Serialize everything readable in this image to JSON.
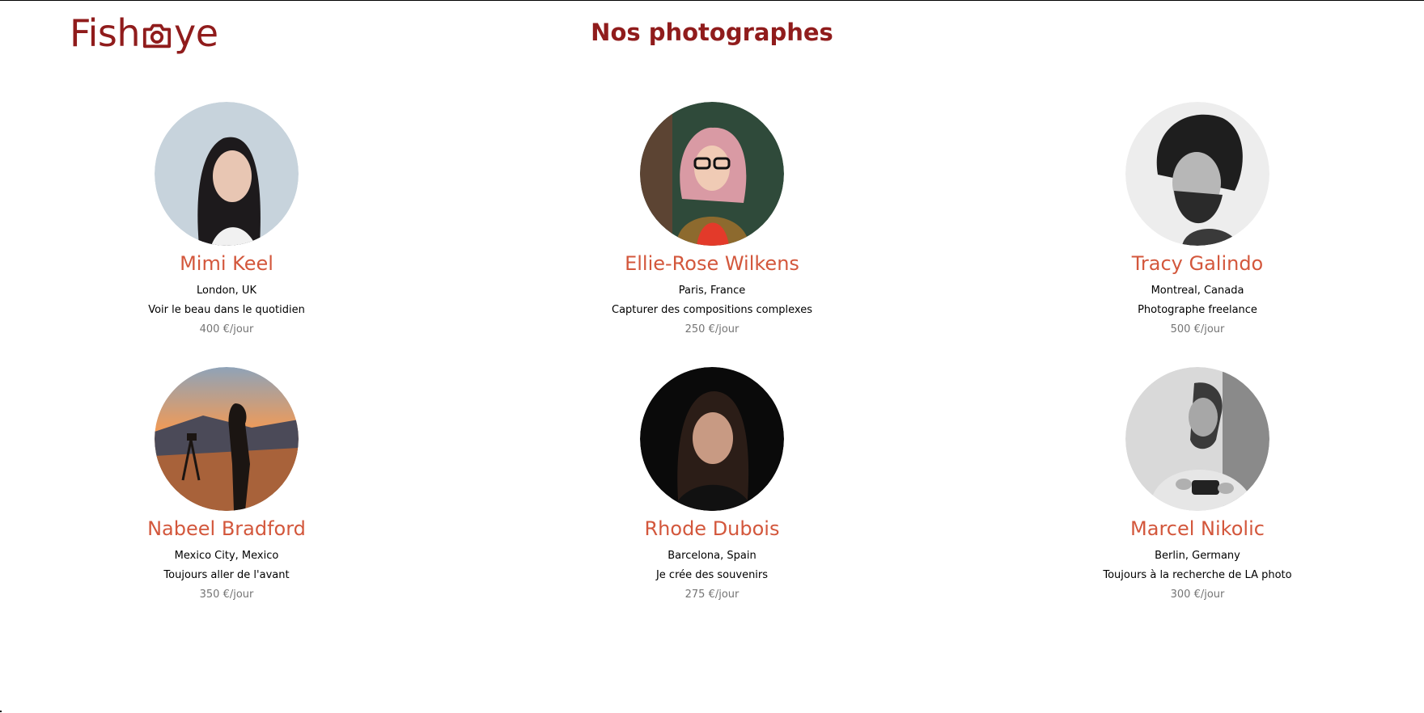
{
  "header": {
    "logo_left": "Fish",
    "logo_right": "ye",
    "logo_icon": "camera-icon",
    "title": "Nos photographes"
  },
  "colors": {
    "brand": "#901C1C",
    "name": "#D3573C",
    "price": "#757575"
  },
  "photographers": [
    {
      "name": "Mimi Keel",
      "city": "London, UK",
      "tagline": "Voir le beau dans le quotidien",
      "price": "400 €/jour"
    },
    {
      "name": "Ellie-Rose Wilkens",
      "city": "Paris, France",
      "tagline": "Capturer des compositions complexes",
      "price": "250 €/jour"
    },
    {
      "name": "Tracy Galindo",
      "city": "Montreal, Canada",
      "tagline": "Photographe freelance",
      "price": "500 €/jour"
    },
    {
      "name": "Nabeel Bradford",
      "city": "Mexico City, Mexico",
      "tagline": "Toujours aller de l'avant",
      "price": "350 €/jour"
    },
    {
      "name": "Rhode Dubois",
      "city": "Barcelona, Spain",
      "tagline": "Je crée des souvenirs",
      "price": "275 €/jour"
    },
    {
      "name": "Marcel Nikolic",
      "city": "Berlin, Germany",
      "tagline": "Toujours à la recherche de LA photo",
      "price": "300 €/jour"
    }
  ]
}
